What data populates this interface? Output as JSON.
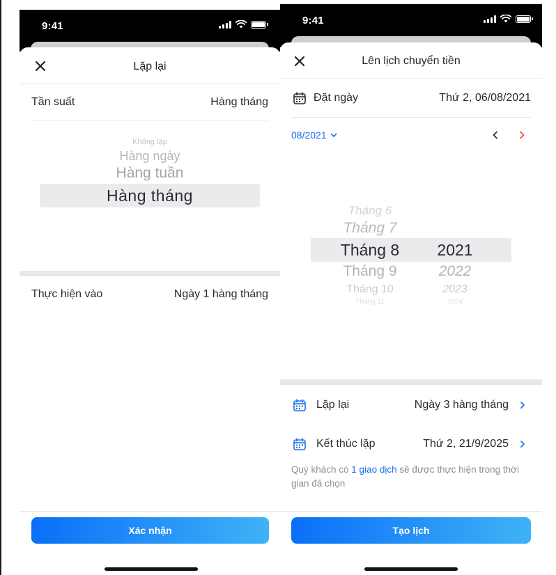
{
  "left": {
    "status_time": "9:41",
    "title": "Lặp lại",
    "frequency_label": "Tần suất",
    "frequency_value": "Hàng tháng",
    "picker_options": [
      "Không lặp",
      "Hàng ngày",
      "Hàng tuần",
      "Hàng tháng"
    ],
    "picker_selected": "Hàng tháng",
    "execute_label": "Thực hiện vào",
    "execute_value": "Ngày 1 hàng tháng",
    "confirm_button": "Xác nhận"
  },
  "right": {
    "status_time": "9:41",
    "title": "Lên lịch chuyển tiền",
    "date_label": "Đặt ngày",
    "date_value": "Thứ 2, 06/08/2021",
    "month_selector": "08/2021",
    "month_options": [
      "Tháng 6",
      "Tháng 7",
      "Tháng 8",
      "Tháng 9",
      "Tháng 10",
      "Tháng 11"
    ],
    "year_options": [
      "2021",
      "2022",
      "2023",
      "2024"
    ],
    "selected_month": "Tháng 8",
    "selected_year": "2021",
    "repeat_label": "Lặp lại",
    "repeat_value": "Ngày 3 hàng tháng",
    "end_label": "Kết thúc lặp",
    "end_value": "Thứ 2, 21/9/2025",
    "note_prefix": "Quý khách có ",
    "note_link": "1 giao dịch",
    "note_suffix": " sẽ được thực hiện trong thời gian đã chọn",
    "create_button": "Tạo lịch"
  },
  "colors": {
    "accent_blue": "#1a73e8",
    "next_arrow_red": "#e5533d",
    "button_gradient_start": "#0a6ff8",
    "button_gradient_end": "#3fb2f7"
  },
  "icons": [
    "close-icon",
    "calendar-icon",
    "chevron-down-icon",
    "chevron-left-icon",
    "chevron-right-icon",
    "signal-icon",
    "wifi-icon",
    "battery-icon"
  ]
}
